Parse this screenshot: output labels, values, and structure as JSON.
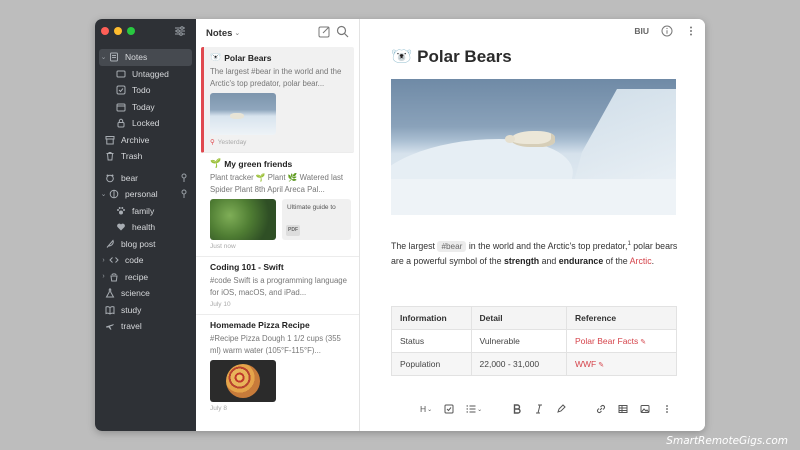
{
  "sidebar": {
    "items": [
      {
        "label": "Notes",
        "icon": "note-icon",
        "level": 0,
        "expanded": true,
        "active": true
      },
      {
        "label": "Untagged",
        "icon": "untagged-icon",
        "level": 1
      },
      {
        "label": "Todo",
        "icon": "todo-icon",
        "level": 1
      },
      {
        "label": "Today",
        "icon": "calendar-icon",
        "level": 1
      },
      {
        "label": "Locked",
        "icon": "lock-icon",
        "level": 1
      },
      {
        "label": "Archive",
        "icon": "archive-icon",
        "level": 0
      },
      {
        "label": "Trash",
        "icon": "trash-icon",
        "level": 0
      },
      {
        "label": "bear",
        "icon": "bear-tag-icon",
        "level": 0,
        "pinned": true
      },
      {
        "label": "personal",
        "icon": "personal-tag-icon",
        "level": 0,
        "expanded": true,
        "pinned": true
      },
      {
        "label": "family",
        "icon": "paw-icon",
        "level": 2
      },
      {
        "label": "health",
        "icon": "heart-icon",
        "level": 2
      },
      {
        "label": "blog post",
        "icon": "feather-icon",
        "level": 0
      },
      {
        "label": "code",
        "icon": "code-icon",
        "level": 0,
        "collapsed": true
      },
      {
        "label": "recipe",
        "icon": "recipe-icon",
        "level": 0,
        "collapsed": true
      },
      {
        "label": "science",
        "icon": "flask-icon",
        "level": 0
      },
      {
        "label": "study",
        "icon": "book-icon",
        "level": 0
      },
      {
        "label": "travel",
        "icon": "plane-icon",
        "level": 0
      }
    ]
  },
  "notelist": {
    "header": "Notes",
    "notes": [
      {
        "emoji": "🐻‍❄️",
        "title": "Polar Bears",
        "snippet": "The largest #bear in the world and the Arctic's top predator, polar bear...",
        "date": "Yesterday"
      },
      {
        "emoji": "🌱",
        "title": "My green friends",
        "snippet": "Plant tracker 🌱 Plant 🌿 Watered last Spider Plant 8th April Areca Pal...",
        "attachment_title": "Ultimate guide to",
        "attachment_badge": "PDF",
        "date": "Just now"
      },
      {
        "title": "Coding 101 - Swift",
        "snippet": "#code Swift is a programming language for iOS, macOS, and iPad...",
        "date": "July 10"
      },
      {
        "title": "Homemade Pizza Recipe",
        "snippet": "#Recipe Pizza Dough 1 1/2 cups (355 ml) warm water (105°F-115°F)...",
        "date": "July 8"
      }
    ]
  },
  "editor": {
    "toolbar": {
      "format_label": "BIU"
    },
    "title_emoji": "🐻‍❄️",
    "title": "Polar Bears",
    "paragraph": {
      "p1": "The largest ",
      "tag": "#bear",
      "p2": " in the world and the Arctic's top predator,",
      "footnote": "1",
      "p3": " polar bears are a powerful symbol of the ",
      "strength": "strength",
      "p4": " and ",
      "endurance": "endurance",
      "p5": " of the ",
      "link": "Arctic",
      "p6": "."
    },
    "table": {
      "headers": [
        "Information",
        "Detail",
        "Reference"
      ],
      "rows": [
        [
          "Status",
          "Vulnerable",
          "Polar Bear Facts"
        ],
        [
          "Population",
          "22,000 - 31,000",
          "WWF"
        ]
      ]
    },
    "bottom_toolbar": {
      "heading_label": "H"
    }
  },
  "watermark": "SmartRemoteGigs.com",
  "colors": {
    "accent": "#d5444b",
    "sidebar_bg": "#2e3136",
    "page_bg": "#bdbdbd"
  }
}
